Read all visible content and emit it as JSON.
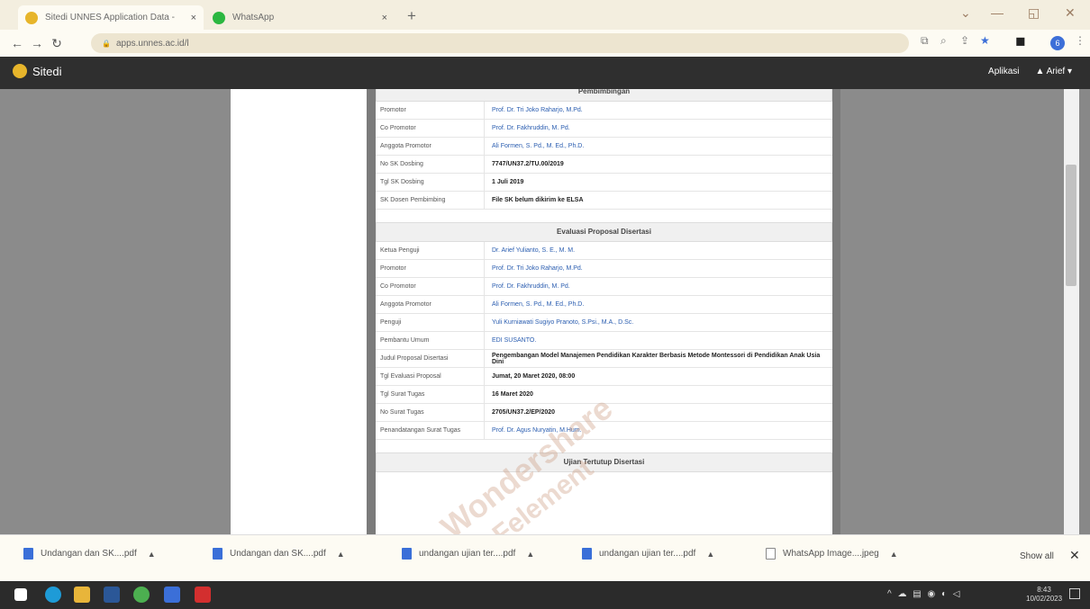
{
  "browser": {
    "tabs": [
      {
        "label": "Sitedi UNNES Application Data -",
        "close": "×"
      },
      {
        "label": "WhatsApp",
        "close": "×"
      }
    ],
    "new_tab": "+",
    "url": "apps.unnes.ac.id/l",
    "profile_initial": "6"
  },
  "app": {
    "brand": "Sitedi",
    "nav": [
      "Aplikasi",
      "Arief"
    ]
  },
  "sections": [
    {
      "title": "Pembimbingan",
      "rows": [
        {
          "label": "Promotor",
          "value": "Prof. Dr. Tri Joko Raharjo, M.Pd.",
          "link": true
        },
        {
          "label": "Co Promotor",
          "value": "Prof. Dr. Fakhruddin, M. Pd.",
          "link": true
        },
        {
          "label": "Anggota Promotor",
          "value": "Ali Formen, S. Pd., M. Ed., Ph.D.",
          "link": true
        },
        {
          "label": "No SK Dosbing",
          "value": "7747/UN37.2/TU.00/2019",
          "link": false
        },
        {
          "label": "Tgl SK Dosbing",
          "value": "1 Juli 2019",
          "link": false
        },
        {
          "label": "SK Dosen Pembimbing",
          "value": "File SK belum dikirim ke ELSA",
          "link": false
        }
      ]
    },
    {
      "title": "Evaluasi Proposal Disertasi",
      "rows": [
        {
          "label": "Ketua Penguji",
          "value": "Dr. Arief Yulianto, S. E., M. M.",
          "link": true
        },
        {
          "label": "Promotor",
          "value": "Prof. Dr. Tri Joko Raharjo, M.Pd.",
          "link": true
        },
        {
          "label": "Co Promotor",
          "value": "Prof. Dr. Fakhruddin, M. Pd.",
          "link": true
        },
        {
          "label": "Anggota Promotor",
          "value": "Ali Formen, S. Pd., M. Ed., Ph.D.",
          "link": true
        },
        {
          "label": "Penguji",
          "value": "Yuli Kurniawati Sugiyo Pranoto, S.Psi., M.A., D.Sc.",
          "link": true
        },
        {
          "label": "Pembantu Umum",
          "value": "EDI SUSANTO.",
          "link": true
        },
        {
          "label": "Judul Proposal Disertasi",
          "value": "Pengembangan Model Manajemen Pendidikan Karakter Berbasis Metode Montessori di Pendidikan Anak Usia Dini",
          "link": false
        },
        {
          "label": "Tgl Evaluasi Proposal",
          "value": "Jumat, 20 Maret 2020, 08:00",
          "link": false
        },
        {
          "label": "Tgl Surat Tugas",
          "value": "16 Maret 2020",
          "link": false
        },
        {
          "label": "No Surat Tugas",
          "value": "2705/UN37.2/EP/2020",
          "link": false
        },
        {
          "label": "Penandatangan Surat Tugas",
          "value": "Prof. Dr. Agus Nuryatin, M.Hum.",
          "link": true
        }
      ]
    },
    {
      "title": "Ujian Tertutup Disertasi",
      "rows": []
    }
  ],
  "downloads": [
    {
      "name": "Undangan dan SK....pdf"
    },
    {
      "name": "Undangan dan SK....pdf"
    },
    {
      "name": "undangan ujian ter....pdf"
    },
    {
      "name": "undangan ujian ter....pdf"
    },
    {
      "name": "WhatsApp Image....jpeg"
    }
  ],
  "downloads_show_all": "Show all",
  "taskbar": {
    "time": "8:43",
    "date": "10/02/2023"
  },
  "watermark": [
    "Wondershare",
    "PDFelement"
  ]
}
